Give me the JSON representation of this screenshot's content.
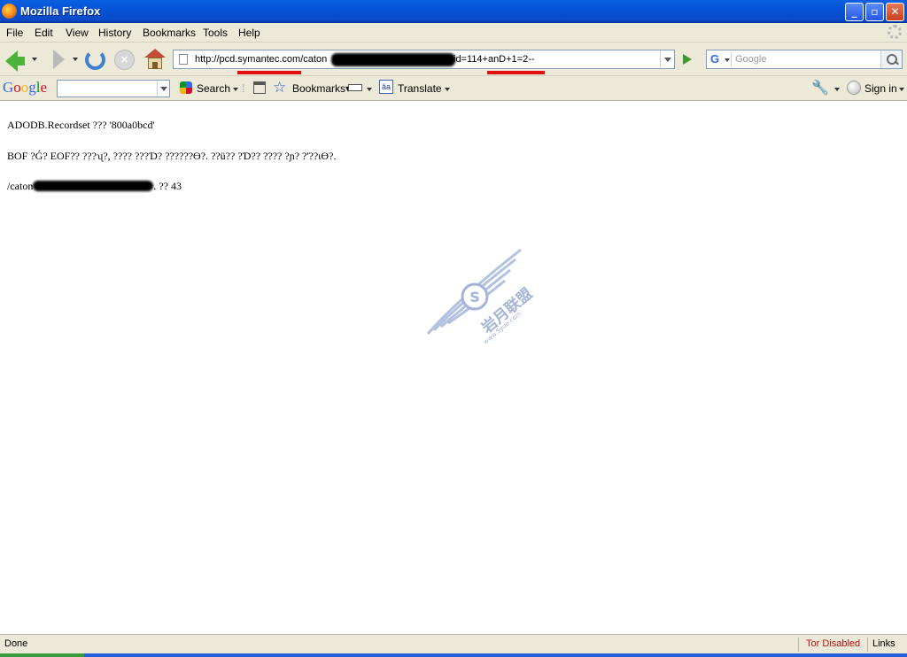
{
  "window": {
    "title": "Mozilla Firefox",
    "controls": {
      "minimize": "_",
      "maximize": "▫",
      "close": "✕"
    }
  },
  "menu": {
    "items": [
      "File",
      "Edit",
      "View",
      "History",
      "Bookmarks",
      "Tools",
      "Help"
    ]
  },
  "nav": {
    "url_prefix": "http://pcd.symantec.com/caton",
    "url_suffix": "id=114+anD+1=2--",
    "search_placeholder": "Google",
    "search_engine_glyph": "G"
  },
  "google_toolbar": {
    "logo": "Google",
    "search_label": "Search",
    "bookmarks_label": "Bookmarks",
    "bookmarks_arrow": "▾",
    "translate_label": "Translate",
    "translate_glyph": "âa",
    "signin_label": "Sign in",
    "wrench_glyph": "🔧",
    "star_glyph": "☆"
  },
  "content": {
    "lines": [
      "ADODB.Recordset ??? '800a0bcd'",
      "BOF ?Ǵ? EOF?? ???ʯ?, ???? ???Ɗ? ??????Ө?. ??ü?? ?Ɗ?? ???? ?ɲ? ?'??ɩӨ?.",
      "/caton",
      ". ?? 43"
    ]
  },
  "watermark": {
    "big_text": "岩月联盟",
    "small_text": "www.5yue.com",
    "badge_glyph": "S"
  },
  "status": {
    "left": "Done",
    "tor": "Tor Disabled",
    "links": "Links"
  },
  "colors": {
    "titlebar": "#0553d8",
    "chrome": "#ece9d8",
    "url_underline": "#e01010",
    "tor_text": "#c01010",
    "watermark": "#8da2cc"
  }
}
